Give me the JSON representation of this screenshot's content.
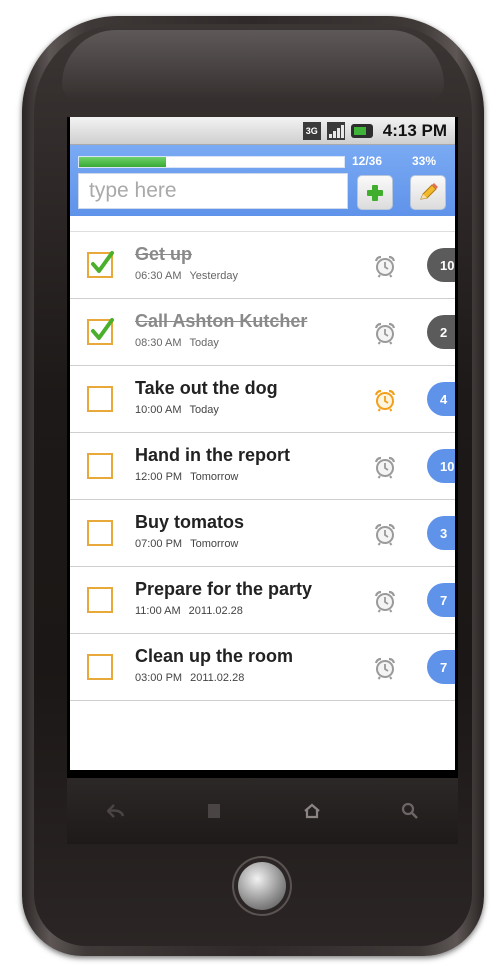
{
  "statusbar": {
    "network_label": "3G",
    "time": "4:13 PM"
  },
  "header": {
    "progress_count": "12/36",
    "progress_percent": "33%",
    "progress_fraction": 0.33,
    "input_placeholder": "type here",
    "input_value": "",
    "add_icon": "plus-icon",
    "edit_icon": "pencil-icon"
  },
  "tasks": [
    {
      "title": "Get up",
      "time": "06:30 AM",
      "day": "Yesterday",
      "done": true,
      "alarm_active": false,
      "count": "10"
    },
    {
      "title": "Call Ashton Kutcher",
      "time": "08:30 AM",
      "day": "Today",
      "done": true,
      "alarm_active": false,
      "count": "2"
    },
    {
      "title": "Take out the dog",
      "time": "10:00 AM",
      "day": "Today",
      "done": false,
      "alarm_active": true,
      "count": "4"
    },
    {
      "title": "Hand in the report",
      "time": "12:00 PM",
      "day": "Tomorrow",
      "done": false,
      "alarm_active": false,
      "count": "10"
    },
    {
      "title": "Buy tomatos",
      "time": "07:00 PM",
      "day": "Tomorrow",
      "done": false,
      "alarm_active": false,
      "count": "3"
    },
    {
      "title": "Prepare for the party",
      "time": "11:00 AM",
      "day": "2011.02.28",
      "done": false,
      "alarm_active": false,
      "count": "7"
    },
    {
      "title": "Clean up the room",
      "time": "03:00 PM",
      "day": "2011.02.28",
      "done": false,
      "alarm_active": false,
      "count": "7"
    }
  ],
  "nav": [
    "back-icon",
    "menu-icon",
    "home-icon",
    "search-icon"
  ],
  "colors": {
    "header_blue": "#6d9ff0",
    "progress_green": "#3fb23a",
    "checkbox_orange": "#e8a93a",
    "check_green": "#4caf2c",
    "badge_done": "#5b5b5b",
    "badge_active": "#5f93ea",
    "alarm_active": "#f2a01c",
    "alarm_idle": "#9a9a9a"
  }
}
